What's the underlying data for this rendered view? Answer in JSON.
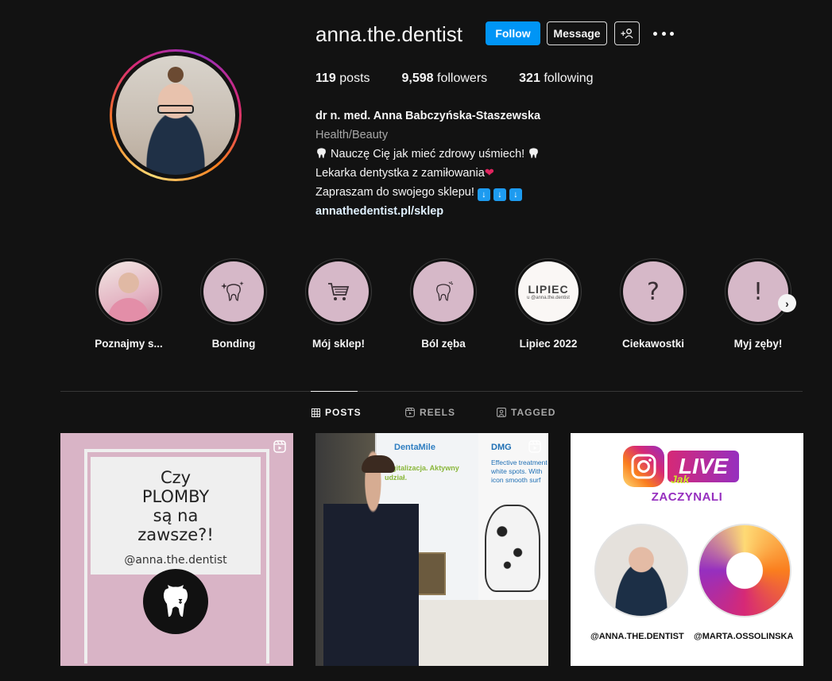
{
  "profile": {
    "username": "anna.the.dentist",
    "follow_label": "Follow",
    "message_label": "Message",
    "suggest_label": "+",
    "posts_count": "119",
    "posts_label": "posts",
    "followers_count": "9,598",
    "followers_label": "followers",
    "following_count": "321",
    "following_label": "following",
    "full_name": "dr n. med. Anna Babczyńska-Staszewska",
    "category": "Health/Beauty",
    "bio_line1": "Nauczę Cię jak mieć zdrowy uśmiech!",
    "bio_line2": "Lekarka dentystka z zamiłowania",
    "bio_line3": "Zapraszam do swojego sklepu!",
    "link": "annathedentist.pl/sklep"
  },
  "highlights": [
    {
      "label": "Poznajmy s...",
      "icon": "photo"
    },
    {
      "label": "Bonding",
      "icon": "sparkle-tooth-icon"
    },
    {
      "label": "Mój sklep!",
      "icon": "cart-icon"
    },
    {
      "label": "Ból zęba",
      "icon": "tooth-icon"
    },
    {
      "label": "Lipiec 2022",
      "icon": "lipiec-cover",
      "cover_title": "LIPIEC",
      "cover_sub": "u @anna.the.dentist"
    },
    {
      "label": "Ciekawostki",
      "icon": "question-icon",
      "glyph": "?"
    },
    {
      "label": "Myj zęby!",
      "icon": "exclamation-icon",
      "glyph": "!"
    }
  ],
  "tabs": {
    "posts": "POSTS",
    "reels": "REELS",
    "tagged": "TAGGED"
  },
  "posts": {
    "p1": {
      "line1": "Czy",
      "line2": "PLOMBY",
      "line3": "są na",
      "line4": "zawsze?!",
      "handle": "@anna.the.dentist"
    },
    "p2": {
      "brand_left": "DentaMile",
      "sub_left": "Digitalizacja. Aktywny udział.",
      "brand_right": "DMG",
      "sub_right": "Effective treatment white spots. With icon smooth surf"
    },
    "p3": {
      "live": "LIVE",
      "jak": "Jak",
      "title": "ZACZYNALI",
      "handle1": "@ANNA.THE.DENTIST",
      "handle2": "@MARTA.OSSOLINSKA"
    }
  },
  "colors": {
    "follow_blue": "#0095f6",
    "highlight_pink": "#d6b8c8",
    "background": "#121212"
  }
}
